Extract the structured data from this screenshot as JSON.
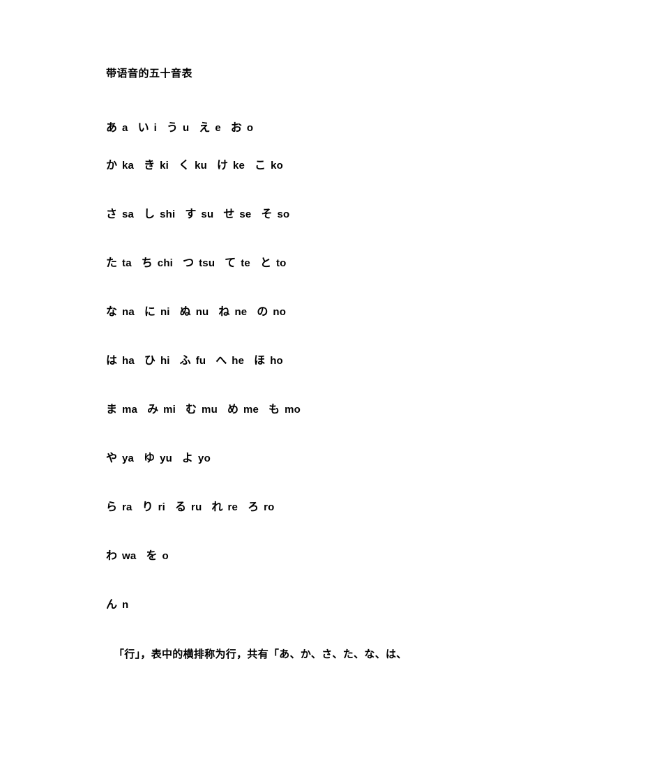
{
  "document": {
    "title": "带语音的五十音表",
    "kana_rows": [
      {
        "row_name": "a-row",
        "pairs": [
          {
            "kana": "あ",
            "romaji": "a"
          },
          {
            "kana": "い",
            "romaji": "i"
          },
          {
            "kana": "う",
            "romaji": "u"
          },
          {
            "kana": "え",
            "romaji": "e"
          },
          {
            "kana": "お",
            "romaji": "o"
          }
        ]
      },
      {
        "row_name": "ka-row",
        "pairs": [
          {
            "kana": "か",
            "romaji": "ka"
          },
          {
            "kana": "き",
            "romaji": "ki"
          },
          {
            "kana": "く",
            "romaji": "ku"
          },
          {
            "kana": "け",
            "romaji": "ke"
          },
          {
            "kana": "こ",
            "romaji": "ko"
          }
        ]
      },
      {
        "row_name": "sa-row",
        "pairs": [
          {
            "kana": "さ",
            "romaji": "sa"
          },
          {
            "kana": "し",
            "romaji": "shi"
          },
          {
            "kana": "す",
            "romaji": "su"
          },
          {
            "kana": "せ",
            "romaji": "se"
          },
          {
            "kana": "そ",
            "romaji": "so"
          }
        ]
      },
      {
        "row_name": "ta-row",
        "pairs": [
          {
            "kana": "た",
            "romaji": "ta"
          },
          {
            "kana": "ち",
            "romaji": "chi"
          },
          {
            "kana": "つ",
            "romaji": "tsu"
          },
          {
            "kana": "て",
            "romaji": "te"
          },
          {
            "kana": "と",
            "romaji": "to"
          }
        ]
      },
      {
        "row_name": "na-row",
        "pairs": [
          {
            "kana": "な",
            "romaji": "na"
          },
          {
            "kana": "に",
            "romaji": "ni"
          },
          {
            "kana": "ぬ",
            "romaji": "nu"
          },
          {
            "kana": "ね",
            "romaji": "ne"
          },
          {
            "kana": "の",
            "romaji": "no"
          }
        ]
      },
      {
        "row_name": "ha-row",
        "pairs": [
          {
            "kana": "は",
            "romaji": "ha"
          },
          {
            "kana": "ひ",
            "romaji": "hi"
          },
          {
            "kana": "ふ",
            "romaji": "fu"
          },
          {
            "kana": "へ",
            "romaji": "he"
          },
          {
            "kana": "ほ",
            "romaji": "ho"
          }
        ]
      },
      {
        "row_name": "ma-row",
        "pairs": [
          {
            "kana": "ま",
            "romaji": "ma"
          },
          {
            "kana": "み",
            "romaji": "mi"
          },
          {
            "kana": "む",
            "romaji": "mu"
          },
          {
            "kana": "め",
            "romaji": "me"
          },
          {
            "kana": "も",
            "romaji": "mo"
          }
        ]
      },
      {
        "row_name": "ya-row",
        "pairs": [
          {
            "kana": "や",
            "romaji": "ya"
          },
          {
            "kana": "ゆ",
            "romaji": "yu"
          },
          {
            "kana": "よ",
            "romaji": "yo"
          }
        ]
      },
      {
        "row_name": "ra-row",
        "pairs": [
          {
            "kana": "ら",
            "romaji": "ra"
          },
          {
            "kana": "り",
            "romaji": "ri"
          },
          {
            "kana": "る",
            "romaji": "ru"
          },
          {
            "kana": "れ",
            "romaji": "re"
          },
          {
            "kana": "ろ",
            "romaji": "ro"
          }
        ]
      },
      {
        "row_name": "wa-row",
        "pairs": [
          {
            "kana": "わ",
            "romaji": "wa"
          },
          {
            "kana": "を",
            "romaji": "o"
          }
        ]
      },
      {
        "row_name": "n-row",
        "pairs": [
          {
            "kana": "ん",
            "romaji": "n"
          }
        ]
      }
    ],
    "note": "「行」，表中的横排称为行，共有「あ、か、さ、た、な、は、"
  }
}
